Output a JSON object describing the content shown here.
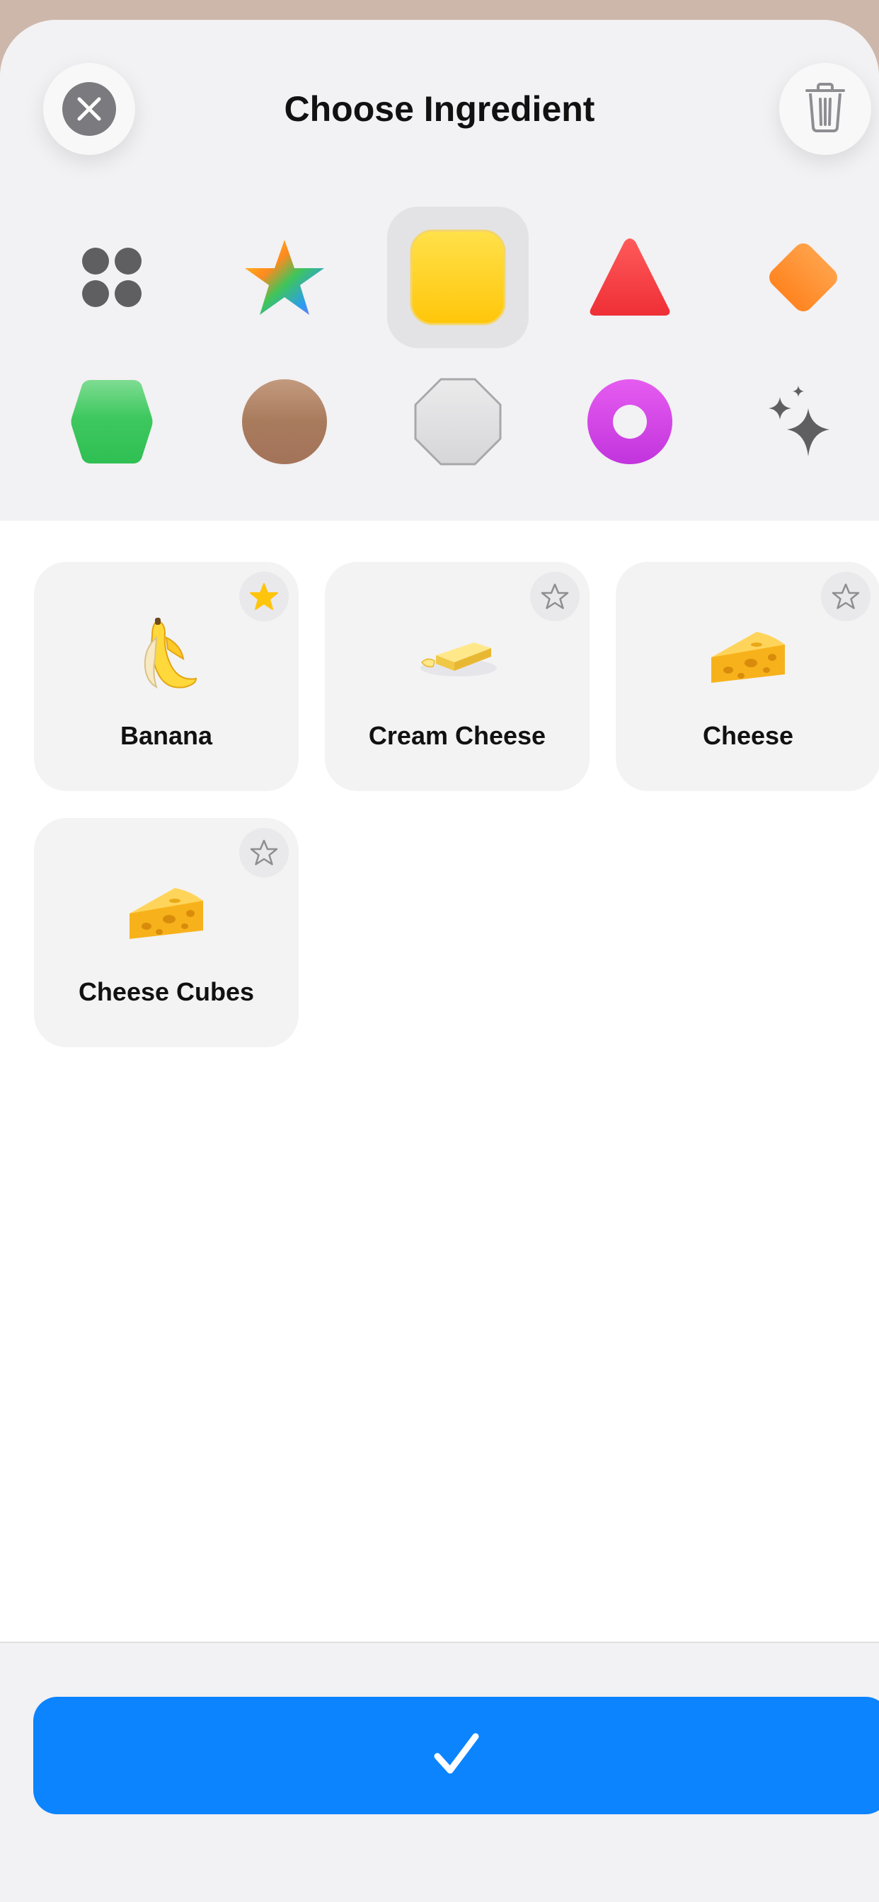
{
  "header": {
    "title": "Choose Ingredient",
    "close_icon": "xmark-circle-icon",
    "trash_icon": "trash-icon"
  },
  "shape_picker": {
    "selected_index": 2,
    "shapes": [
      {
        "name": "four-dots-shape",
        "color": "#5f5f62"
      },
      {
        "name": "star-shape",
        "color": "multicolor"
      },
      {
        "name": "rounded-square-shape",
        "color": "#ffcf0f"
      },
      {
        "name": "triangle-shape",
        "color": "#f53a3f"
      },
      {
        "name": "diamond-shape",
        "color": "#ff8f2e"
      },
      {
        "name": "hexagon-shape",
        "color": "#37c55a"
      },
      {
        "name": "circle-shape",
        "color": "#a97b5d"
      },
      {
        "name": "octagon-shape",
        "color": "#d8d8da"
      },
      {
        "name": "ring-shape",
        "color": "#d13fe8"
      },
      {
        "name": "sparkles-shape",
        "color": "#5f5f62"
      }
    ]
  },
  "ingredients": [
    {
      "label": "Banana",
      "emoji": "🍌",
      "favorite": true
    },
    {
      "label": "Cream Cheese",
      "emoji": "🧈",
      "favorite": false
    },
    {
      "label": "Cheese",
      "emoji": "🧀",
      "favorite": false
    },
    {
      "label": "Cheese Cubes",
      "emoji": "🧀",
      "favorite": false
    }
  ],
  "footer": {
    "confirm_icon": "checkmark-icon",
    "accent_color": "#0b84fe",
    "favorite_color": "#ffc40c"
  }
}
